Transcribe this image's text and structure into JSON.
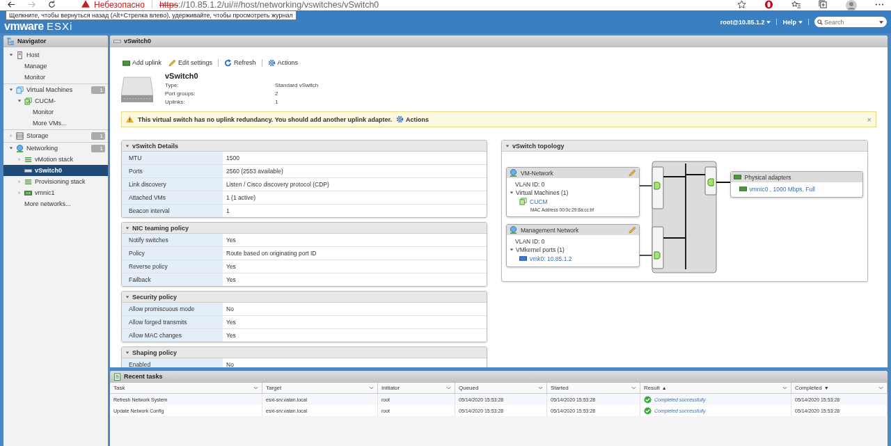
{
  "browser": {
    "warning": "Небезопасно",
    "url_scheme": "https",
    "url_rest": "://10.85.1.2/ui/#/host/networking/vswitches/vSwitch0",
    "tooltip": "Щелкните, чтобы вернуться назад (Alt+Стрелка влево), удерживайте, чтобы просмотреть журнал"
  },
  "header": {
    "brand": "vmware",
    "product": "ESXi",
    "user": "root@10.85.1.2",
    "help": "Help",
    "search": {
      "placeholder": "Search"
    }
  },
  "navigator": {
    "title": "Navigator",
    "items": [
      {
        "label": "Host",
        "kind": "host",
        "expanded": true,
        "selected": false,
        "children": [
          {
            "label": "Manage",
            "selected": false
          },
          {
            "label": "Monitor",
            "selected": false
          }
        ]
      },
      {
        "label": "Virtual Machines",
        "kind": "vms",
        "expanded": true,
        "selected": false,
        "badge": "1",
        "children": [
          {
            "label": "CUCM-",
            "kind": "vm",
            "expanded": true,
            "selected": false,
            "children": [
              {
                "label": "Monitor",
                "selected": false
              },
              {
                "label": "More VMs...",
                "selected": false
              }
            ]
          }
        ]
      },
      {
        "label": "Storage",
        "kind": "storage",
        "expanded": false,
        "selected": false,
        "badge": "1"
      },
      {
        "label": "Networking",
        "kind": "network",
        "expanded": true,
        "selected": false,
        "badge": "1",
        "children": [
          {
            "label": "vMotion stack",
            "kind": "stack",
            "expanded": false,
            "selected": false
          },
          {
            "label": "vSwitch0",
            "kind": "switch",
            "selected": true
          },
          {
            "label": "Provisioning stack",
            "kind": "stack",
            "expanded": false,
            "selected": false
          },
          {
            "label": "vmnic1",
            "kind": "nic",
            "expanded": false,
            "selected": false
          },
          {
            "label": "More networks...",
            "selected": false
          }
        ]
      }
    ]
  },
  "main": {
    "title": "vSwitch0",
    "toolbar": [
      {
        "label": "Add uplink",
        "kind": "nic"
      },
      {
        "label": "Edit settings",
        "kind": "pencil"
      },
      {
        "label": "Refresh",
        "kind": "refresh"
      },
      {
        "label": "Actions",
        "kind": "gear"
      }
    ],
    "summary": {
      "name": "vSwitch0",
      "props": [
        {
          "label": "Type:",
          "value": "Standard vSwitch"
        },
        {
          "label": "Port groups:",
          "value": "2"
        },
        {
          "label": "Uplinks:",
          "value": "1"
        }
      ]
    },
    "warning": {
      "text": "This virtual switch has no uplink redundancy. You should add another uplink adapter.",
      "action": "Actions",
      "close": "×"
    },
    "sections": [
      {
        "title": "vSwitch Details",
        "expanded": true,
        "rows": [
          {
            "label": "MTU",
            "value": "1500"
          },
          {
            "label": "Ports",
            "value": "2560 (2553 available)"
          },
          {
            "label": "Link discovery",
            "value": "Listen / Cisco discovery protocol (CDP)"
          },
          {
            "label": "Attached VMs",
            "value": "1 (1 active)"
          },
          {
            "label": "Beacon interval",
            "value": "1"
          }
        ]
      },
      {
        "title": "NIC teaming policy",
        "expanded": true,
        "rows": [
          {
            "label": "Notify switches",
            "value": "Yes"
          },
          {
            "label": "Policy",
            "value": "Route based on originating port ID"
          },
          {
            "label": "Reverse policy",
            "value": "Yes"
          },
          {
            "label": "Failback",
            "value": "Yes"
          }
        ]
      },
      {
        "title": "Security policy",
        "expanded": true,
        "rows": [
          {
            "label": "Allow promiscuous mode",
            "value": "No"
          },
          {
            "label": "Allow forged transmits",
            "value": "Yes"
          },
          {
            "label": "Allow MAC changes",
            "value": "Yes"
          }
        ]
      },
      {
        "title": "Shaping policy",
        "expanded": true,
        "rows": [
          {
            "label": "Enabled",
            "value": "No"
          }
        ]
      }
    ],
    "topology": {
      "title": "vSwitch topology",
      "expanded": true,
      "port_groups": [
        {
          "name": "VM-Network",
          "vlan": "VLAN ID: 0",
          "group": "Virtual Machines (1)",
          "expanded": true,
          "items": [
            {
              "kind": "vm",
              "label": "CUCM",
              "detail": "MAC Address 00:0c:29:8a:cc:bf"
            }
          ]
        },
        {
          "name": "Management Network",
          "vlan": "VLAN ID: 0",
          "group": "VMkernel ports (1)",
          "expanded": true,
          "items": [
            {
              "kind": "vmk",
              "label": "vmk0: 10.85.1.2"
            }
          ]
        }
      ],
      "physical": {
        "title": "Physical adapters",
        "items": [
          {
            "label": "vmnic0 , 1000 Mbps, Full"
          }
        ]
      }
    }
  },
  "tasks": {
    "title": "Recent tasks",
    "columns": [
      {
        "label": "Task"
      },
      {
        "label": "Target"
      },
      {
        "label": "Initiator"
      },
      {
        "label": "Queued"
      },
      {
        "label": "Started"
      },
      {
        "label": "Result",
        "sort_mark": "▲"
      },
      {
        "label": "Completed",
        "sort_mark": "▼"
      }
    ],
    "rows": [
      {
        "cells": [
          "Refresh Network System",
          "esxi-srv.vatan.local",
          "root",
          "05/14/2020 15:53:28",
          "05/14/2020 15:53:28",
          "Completed successfully",
          "05/14/2020 15:53:28"
        ],
        "kind": "success"
      },
      {
        "cells": [
          "Update Network Config",
          "esxi-srv.vatan.local",
          "root",
          "05/14/2020 15:53:28",
          "05/14/2020 15:53:28",
          "Completed successfully",
          "05/14/2020 15:53:28"
        ],
        "kind": "success"
      }
    ]
  }
}
